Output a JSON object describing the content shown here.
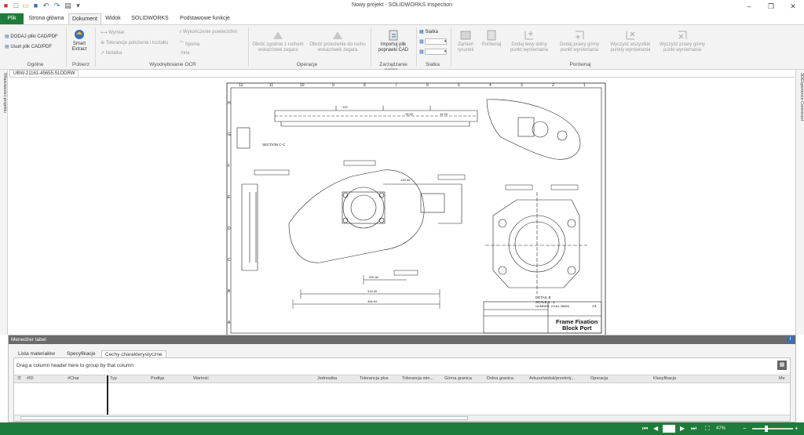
{
  "window": {
    "title": "Nowy projekt - SOLIDWORKS Inspection"
  },
  "tabs": [
    {
      "label": "Plik"
    },
    {
      "label": "Strona główna"
    },
    {
      "label": "Dokument"
    },
    {
      "label": "Widok"
    },
    {
      "label": "SOLIDWORKS PDM"
    },
    {
      "label": "Podstawowe funkcje"
    }
  ],
  "ribbon": {
    "ogolne": {
      "add_label": "DODAJ pliki CAD/PDF",
      "remove_label": "Usuń plik CAD/PDF",
      "group_label": "Ogólne"
    },
    "pobierz": {
      "smart_extract_line1": "Smart",
      "smart_extract_line2": "Extract",
      "group_label": "Pobierz"
    },
    "ocr": {
      "wymiar": "Wymiar",
      "tolerancje": "Tolerancje położenia i kształtu",
      "notatka": "Notatka",
      "wykonczenie": "Wykończenie powierzchni",
      "spoina": "Spoina",
      "inne": "Inne",
      "group_label": "Wyodrębnianie OCR"
    },
    "operacje": {
      "cw_line1": "Obróć zgodnie z ruchem",
      "cw_line2": "wskazówek zegara",
      "ccw_line1": "Obróć przeciwnie do ruchu",
      "ccw_line2": "wskazówek zegara",
      "group_label": "Operacje"
    },
    "zarzadzanie": {
      "import_line1": "Importuj plik",
      "import_line2": "poprawki CAD",
      "group_label": "Zarządzanie popra..."
    },
    "siatka": {
      "siatka_label": "Siatka",
      "group_label": "Siatka"
    },
    "porownaj": {
      "zamien_line1": "Zamień",
      "zamien_line2": "rysunek",
      "porownaj_label": "Porównaj",
      "dodaj_lewy_line1": "Dodaj lewy dolny",
      "dodaj_lewy_line2": "punkt wyrównania",
      "dodaj_prawy_line1": "Dodaj prawy górny",
      "dodaj_prawy_line2": "punkt wyrównania",
      "wyczysc_wszystkie_line1": "Wyczyść wszystkie",
      "wyczysc_wszystkie_line2": "punkty wyrównania",
      "wyczysc_prawy_line1": "Wyczyść prawy górny",
      "wyczysc_prawy_line2": "punkt wyrównania",
      "group_label": "Porównaj"
    }
  },
  "sidebars": {
    "left_label": "Właściwości projektu",
    "right_label": "3DExperience Connector"
  },
  "document": {
    "tab_label": "UBW-21161-45655.SLDDRW",
    "col_numbers": [
      "12",
      "11",
      "10",
      "9",
      "8",
      "7",
      "6",
      "5",
      "4",
      "3",
      "2",
      "1"
    ],
    "row_letters": [
      "H",
      "G",
      "F",
      "E",
      "D",
      "C",
      "B",
      "A"
    ],
    "section_label": "SECTION C-C",
    "detail_label": "DETAIL B",
    "detail_scale": "SCALE 1 : 1",
    "title_block": {
      "title_line1": "Frame Fixation",
      "title_line2": "Block Port",
      "number_label": "NUMBER: 21161-45655",
      "size": "A3"
    },
    "dims": {
      "d1": "316.30",
      "d2": "456.94",
      "d3": "135.50",
      "d4": "120",
      "d5": "250.50",
      "d6": "16.50",
      "d7": "15.20"
    }
  },
  "manager": {
    "title": "Menedżer tabel",
    "pin_label": "I",
    "tabs": [
      {
        "label": "Lista materiałów"
      },
      {
        "label": "Specyfikacje"
      },
      {
        "label": "Cechy charakterystyczne"
      }
    ],
    "group_hint": "Drag a column header here to group by that column",
    "columns": [
      "#ID",
      "#Char",
      "Typ",
      "Podtyp",
      "Wartość",
      "Jednostka",
      "Tolerancja plus",
      "Tolerancja min...",
      "Górna granica",
      "Dolna granica",
      "Arkusz/widok/przekrój...",
      "Operacja",
      "Klasyfikacja",
      "Me"
    ]
  },
  "status": {
    "zoom": "47%"
  },
  "colors": {
    "accent": "#1e7c3a",
    "ribbon_bg": "#f3f3f3",
    "manager_header": "#6a6a6a"
  }
}
